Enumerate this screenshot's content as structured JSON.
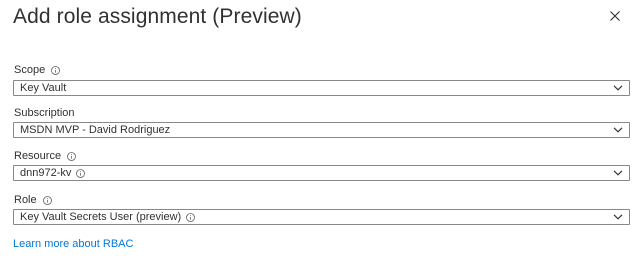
{
  "title": "Add role assignment (Preview)",
  "fields": [
    {
      "label": "Scope",
      "value": "Key Vault",
      "value_info_icon": false
    },
    {
      "label": "Subscription",
      "value": "MSDN MVP - David Rodriguez",
      "value_info_icon": false
    },
    {
      "label": "Resource",
      "value": "dnn972-kv",
      "value_info_icon": true
    },
    {
      "label": "Role",
      "value": "Key Vault Secrets User (preview)",
      "value_info_icon": true
    }
  ],
  "learn_more_link": "Learn more about RBAC",
  "icons": {
    "close": "close-icon",
    "info": "info-icon",
    "chevron": "chevron-down-icon"
  },
  "colors": {
    "text": "#323130",
    "border": "#8a8886",
    "link": "#0078d4"
  }
}
